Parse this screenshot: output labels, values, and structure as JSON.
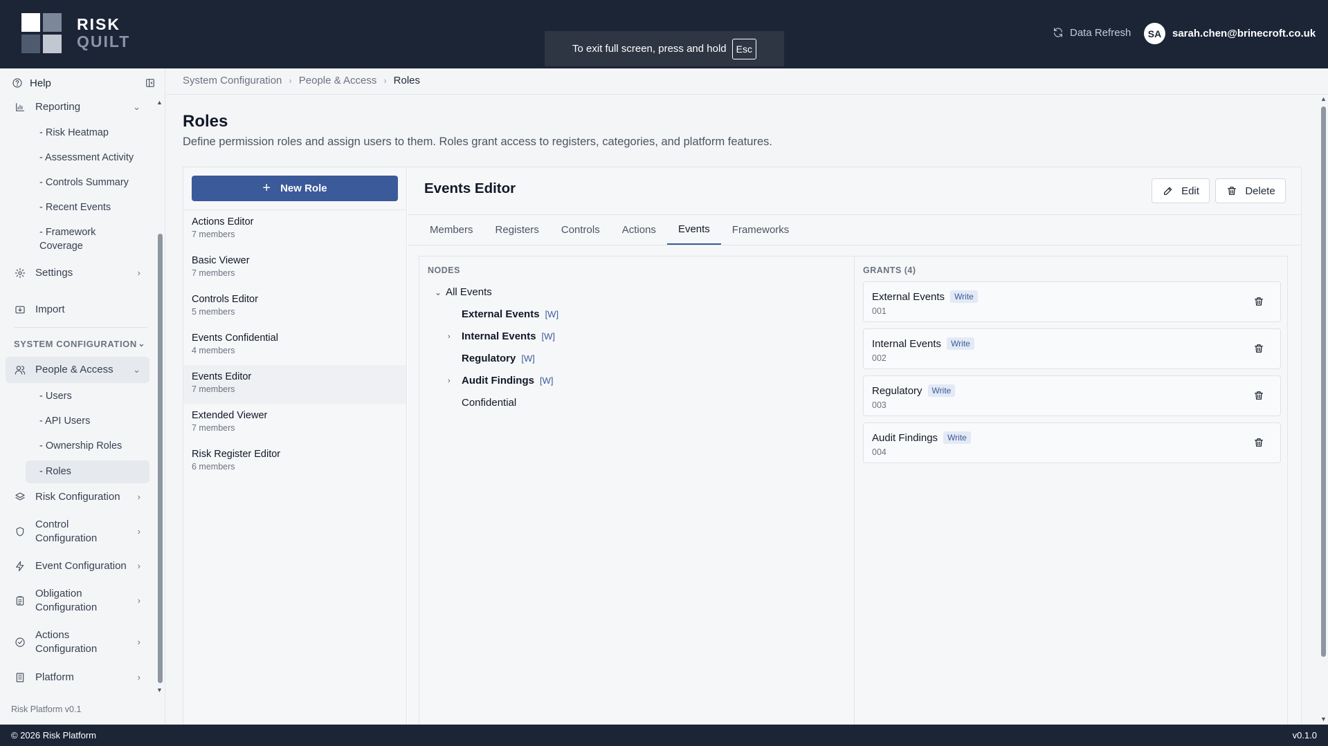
{
  "header": {
    "logo_line1": "RISK",
    "logo_line2": "QUILT",
    "fullscreen_toast": "To exit full screen, press and hold",
    "fullscreen_key": "Esc",
    "refresh_label": "Data Refresh",
    "user_initials": "SA",
    "user_email": "sarah.chen@brinecroft.co.uk"
  },
  "sidebar": {
    "help": "Help",
    "reporting": "Reporting",
    "reporting_items": [
      "- Risk Heatmap",
      "- Assessment Activity",
      "- Controls Summary",
      "- Recent Events",
      "- Framework",
      "Coverage"
    ],
    "settings": "Settings",
    "import": "Import",
    "section_system": "SYSTEM CONFIGURATION",
    "people_access": "People & Access",
    "people_items": [
      "- Users",
      "- API Users",
      "- Ownership Roles",
      "- Roles"
    ],
    "risk_config": "Risk Configuration",
    "control_config_1": "Control",
    "control_config_2": "Configuration",
    "event_config": "Event Configuration",
    "obligation_config_1": "Obligation",
    "obligation_config_2": "Configuration",
    "actions_config_1": "Actions",
    "actions_config_2": "Configuration",
    "platform": "Platform",
    "version": "Risk Platform v0.1"
  },
  "breadcrumb": [
    "System Configuration",
    "People & Access",
    "Roles"
  ],
  "page": {
    "title": "Roles",
    "description": "Define permission roles and assign users to them. Roles grant access to registers, categories, and platform features."
  },
  "roles": {
    "new_role_label": "New Role",
    "items": [
      {
        "name": "Actions Editor",
        "count": "7 members"
      },
      {
        "name": "Basic Viewer",
        "count": "7 members"
      },
      {
        "name": "Controls Editor",
        "count": "5 members"
      },
      {
        "name": "Events Confidential",
        "count": "4 members"
      },
      {
        "name": "Events Editor",
        "count": "7 members"
      },
      {
        "name": "Extended Viewer",
        "count": "7 members"
      },
      {
        "name": "Risk Register Editor",
        "count": "6 members"
      }
    ]
  },
  "detail": {
    "title": "Events Editor",
    "edit_label": "Edit",
    "delete_label": "Delete",
    "tabs": [
      "Members",
      "Registers",
      "Controls",
      "Actions",
      "Events",
      "Frameworks"
    ],
    "nodes_label": "NODES",
    "grants_label": "GRANTS (4)",
    "nodes": {
      "root": "All Events",
      "items": [
        {
          "name": "External Events",
          "tag": "[W]"
        },
        {
          "name": "Internal Events",
          "tag": "[W]"
        },
        {
          "name": "Regulatory",
          "tag": "[W]"
        },
        {
          "name": "Audit Findings",
          "tag": "[W]"
        },
        {
          "name": "Confidential",
          "tag": ""
        }
      ]
    },
    "grants": [
      {
        "name": "External Events",
        "perm": "Write",
        "code": "001"
      },
      {
        "name": "Internal Events",
        "perm": "Write",
        "code": "002"
      },
      {
        "name": "Regulatory",
        "perm": "Write",
        "code": "003"
      },
      {
        "name": "Audit Findings",
        "perm": "Write",
        "code": "004"
      }
    ]
  },
  "footer": {
    "copyright": "© 2026 Risk Platform",
    "version": "v0.1.0"
  },
  "colors": {
    "header_bg": "#1c2536",
    "accent": "#3b5a99",
    "badge_bg": "#e3e9f5"
  }
}
